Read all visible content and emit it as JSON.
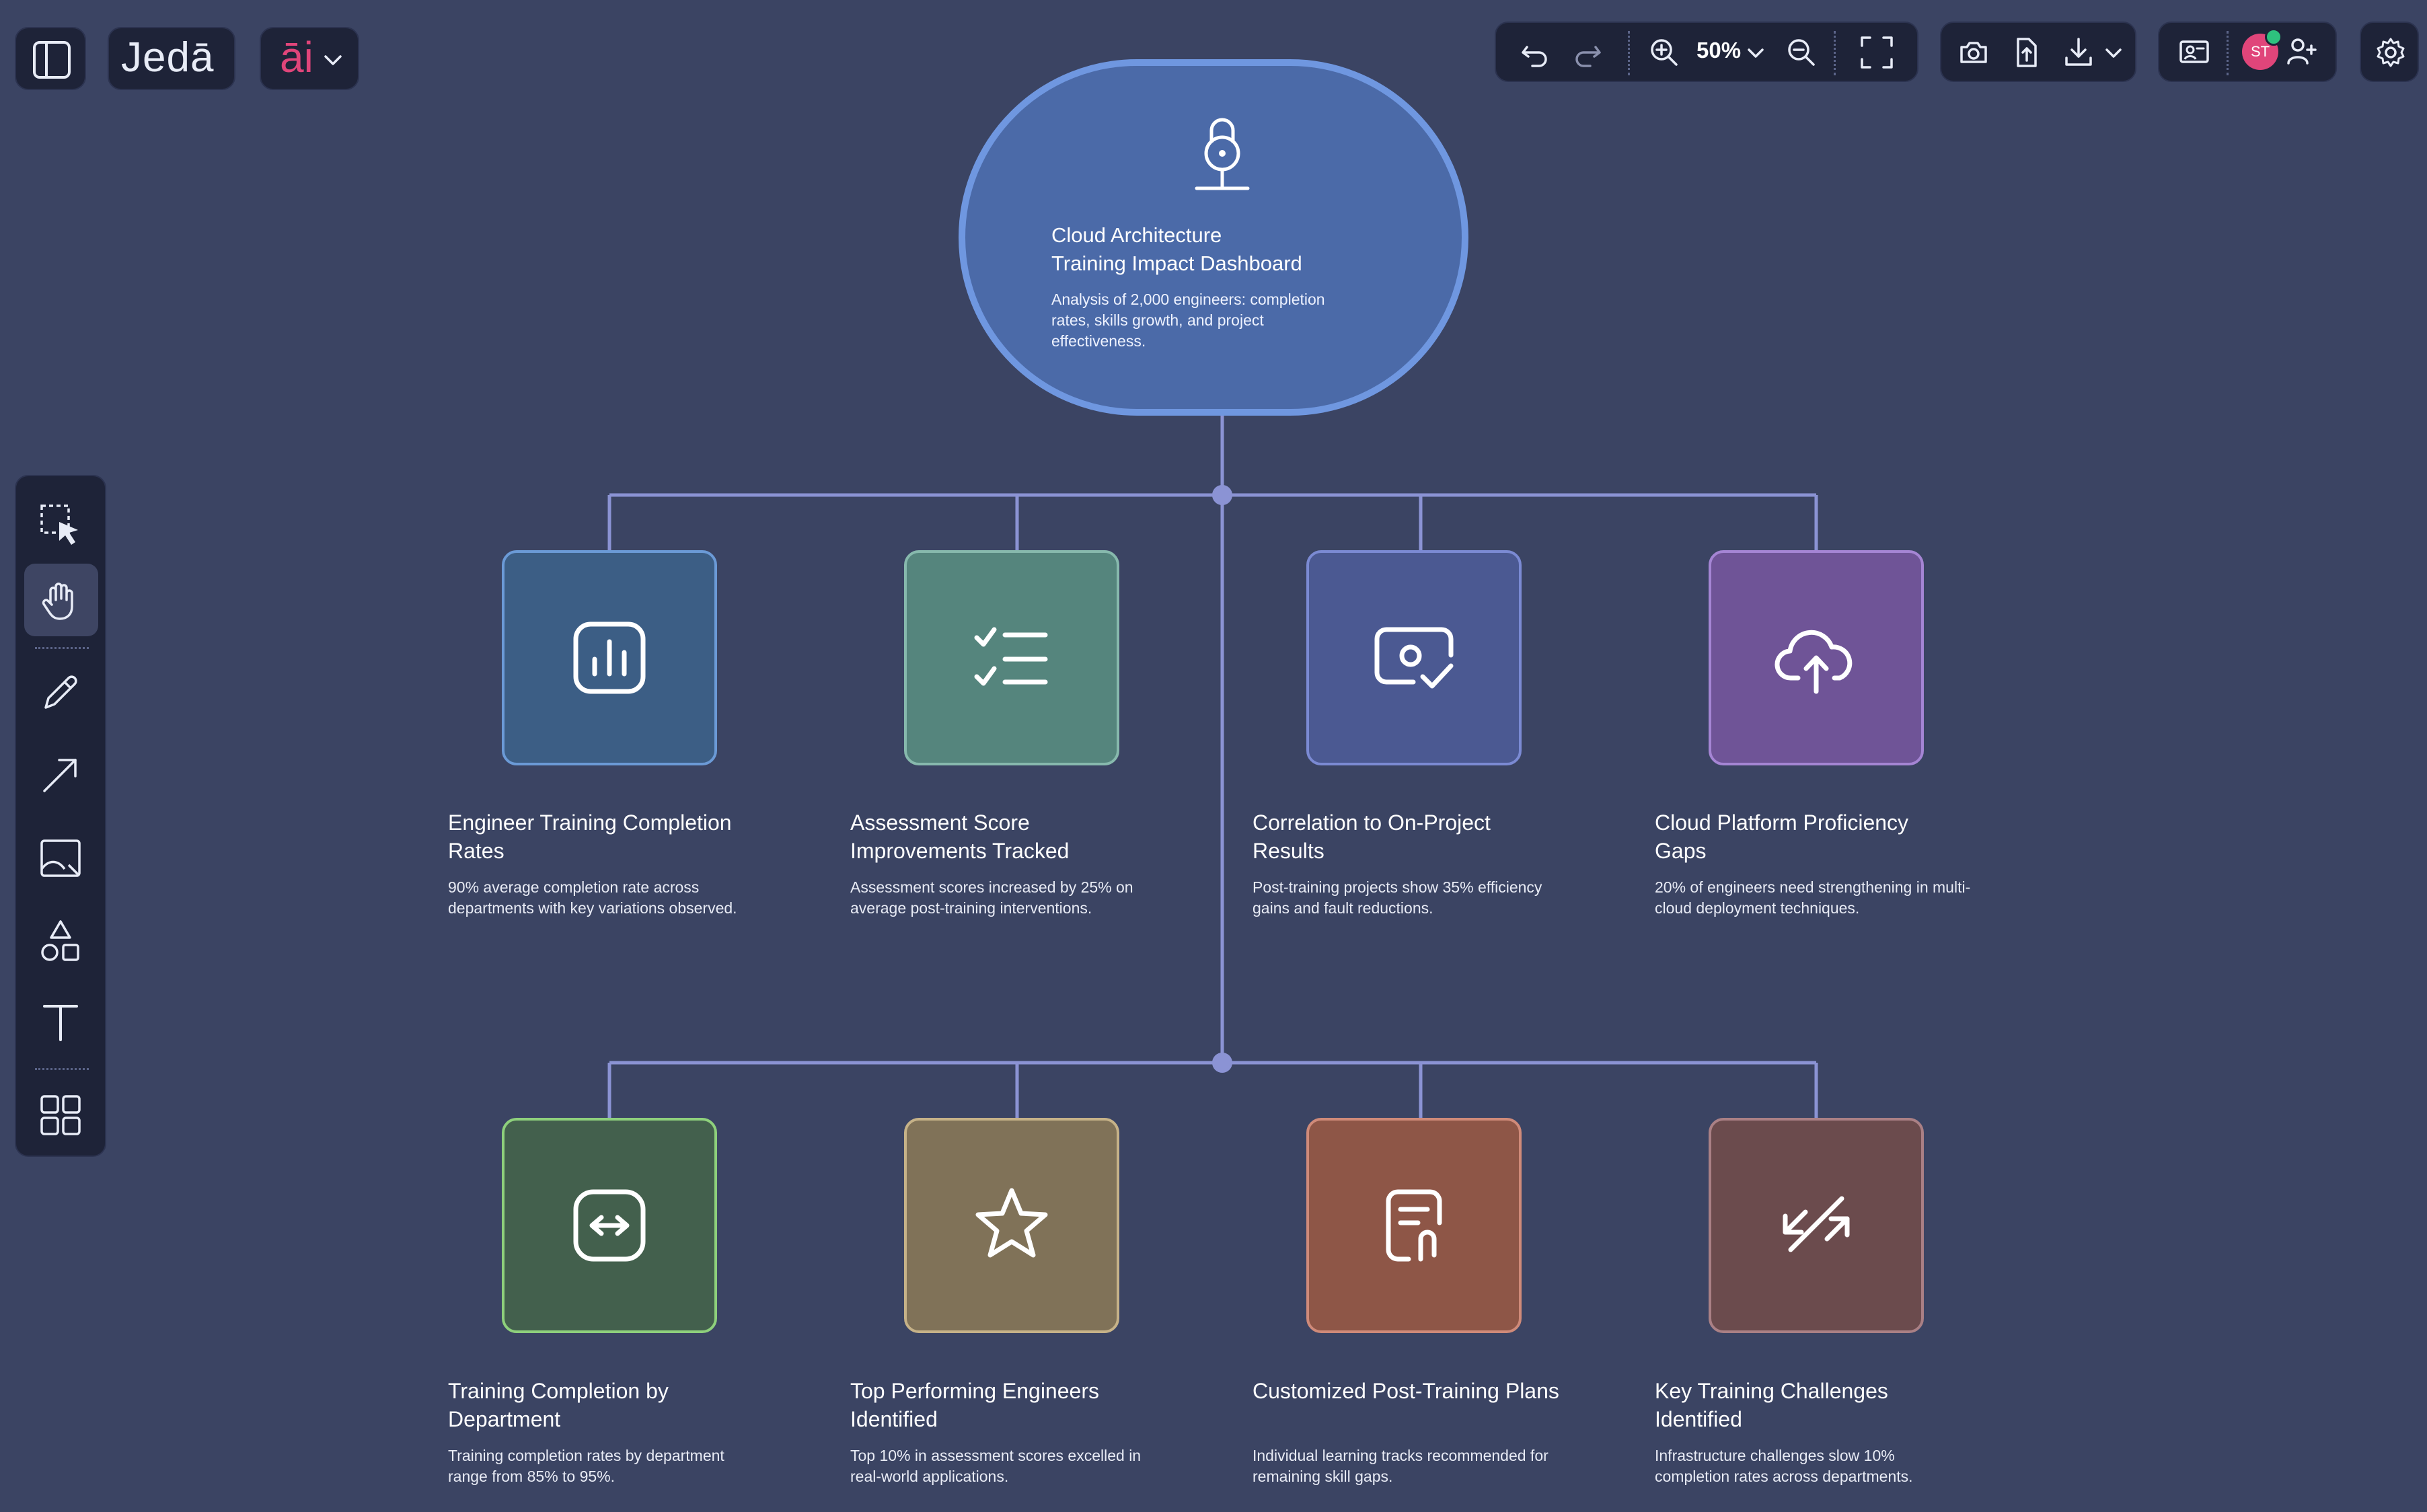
{
  "app": {
    "logo": "Jedā",
    "ai_label": "āi"
  },
  "toolbar": {
    "zoom_level": "50%",
    "user_initials": "ST"
  },
  "colors": {
    "background": "#3b4463",
    "panel": "#1e2338",
    "connector": "#8b93d4",
    "hero_fill": "#4b6aa8",
    "hero_border": "#6f97e0",
    "accent_pink": "#e0457a"
  },
  "hero": {
    "icon": "lock-icon",
    "title_line1": "Cloud Architecture",
    "title_line2": "Training Impact Dashboard",
    "description": "Analysis of 2,000 engineers: completion rates, skills growth, and project effectiveness."
  },
  "cards": [
    {
      "icon": "bar-chart-icon",
      "fill": "#3c5e85",
      "border": "#6b9ad6",
      "title": "Engineer Training Completion Rates",
      "description": "90% average completion rate across departments with key variations observed."
    },
    {
      "icon": "checklist-icon",
      "fill": "#55857d",
      "border": "#87b9ad",
      "title": "Assessment Score Improvements Tracked",
      "description": "Assessment scores increased by 25% on average post-training interventions."
    },
    {
      "icon": "money-check-icon",
      "fill": "#4b5992",
      "border": "#7b8ad3",
      "title": "Correlation to On-Project Results",
      "description": "Post-training projects show 35% efficiency gains and fault reductions."
    },
    {
      "icon": "cloud-upload-icon",
      "fill": "#6f5497",
      "border": "#a585d4",
      "title": "Cloud Platform Proficiency Gaps",
      "description": "20% of engineers need strengthening in multi-cloud deployment techniques."
    },
    {
      "icon": "arrows-exchange-icon",
      "fill": "#43604d",
      "border": "#8ed07c",
      "title": "Training Completion by Department",
      "description": "Training completion rates by department range from 85% to 95%."
    },
    {
      "icon": "star-icon",
      "fill": "#807258",
      "border": "#c6b288",
      "title": "Top Performing Engineers Identified",
      "description": "Top 10% in assessment scores excelled in real-world applications."
    },
    {
      "icon": "document-clip-icon",
      "fill": "#8e5647",
      "border": "#cf8a79",
      "title": "Customized Post-Training Plans",
      "description": "Individual learning tracks recommended for remaining skill gaps."
    },
    {
      "icon": "slash-arrows-icon",
      "fill": "#6b4b4d",
      "border": "#aa8085",
      "title": "Key Training Challenges Identified",
      "description": "Infrastructure challenges slow 10% completion rates across departments."
    }
  ]
}
